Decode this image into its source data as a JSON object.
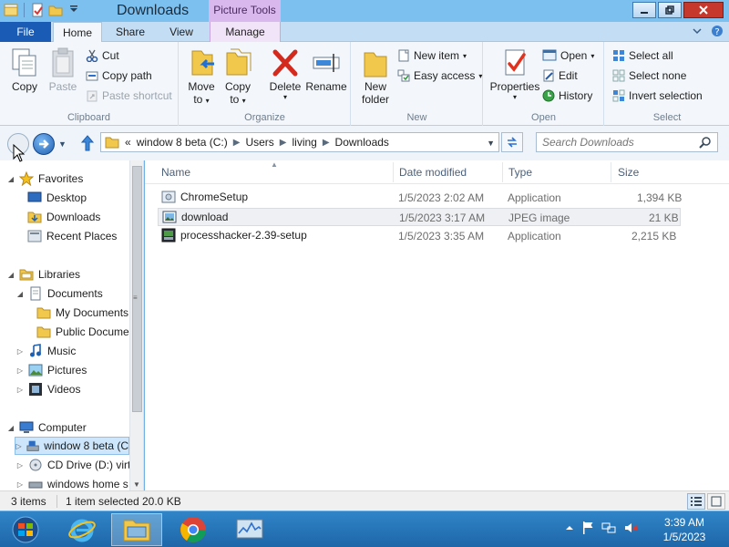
{
  "window": {
    "title": "Downloads",
    "contextual_tab_header": "Picture Tools"
  },
  "tabs": {
    "file": "File",
    "home": "Home",
    "share": "Share",
    "view": "View",
    "manage": "Manage"
  },
  "ribbon": {
    "clipboard": {
      "label": "Clipboard",
      "copy": "Copy",
      "paste": "Paste",
      "cut": "Cut",
      "copy_path": "Copy path",
      "paste_shortcut": "Paste shortcut"
    },
    "organize": {
      "label": "Organize",
      "move_to_1": "Move",
      "move_to_2": "to",
      "copy_to_1": "Copy",
      "copy_to_2": "to",
      "delete": "Delete",
      "rename": "Rename"
    },
    "new": {
      "label": "New",
      "new_folder_1": "New",
      "new_folder_2": "folder",
      "new_item": "New item",
      "easy_access": "Easy access"
    },
    "open": {
      "label": "Open",
      "properties": "Properties",
      "open": "Open",
      "edit": "Edit",
      "history": "History"
    },
    "select": {
      "label": "Select",
      "select_all": "Select all",
      "select_none": "Select none",
      "invert_selection": "Invert selection"
    }
  },
  "address": {
    "overflow": "«",
    "crumbs": [
      "window 8 beta (C:)",
      "Users",
      "living",
      "Downloads"
    ],
    "search_placeholder": "Search Downloads"
  },
  "navpane": {
    "favorites": "Favorites",
    "desktop": "Desktop",
    "downloads": "Downloads",
    "recent_places": "Recent Places",
    "libraries": "Libraries",
    "documents": "Documents",
    "my_documents": "My Documents",
    "public_documents": "Public Docume",
    "music": "Music",
    "pictures": "Pictures",
    "videos": "Videos",
    "computer": "Computer",
    "drive_c": "window 8 beta (C",
    "drive_d": "CD Drive (D:) virt",
    "drive_home": "windows home s"
  },
  "filelist": {
    "columns": {
      "name": "Name",
      "date": "Date modified",
      "type": "Type",
      "size": "Size"
    },
    "rows": [
      {
        "name": "ChromeSetup",
        "date": "1/5/2023 2:02 AM",
        "type": "Application",
        "size": "1,394 KB"
      },
      {
        "name": "download",
        "date": "1/5/2023 3:17 AM",
        "type": "JPEG image",
        "size": "21 KB"
      },
      {
        "name": "processhacker-2.39-setup",
        "date": "1/5/2023 3:35 AM",
        "type": "Application",
        "size": "2,215 KB"
      }
    ]
  },
  "status": {
    "count": "3 items",
    "selection": "1 item selected",
    "size": "20.0 KB"
  },
  "taskbar": {
    "time": "3:39 AM",
    "date": "1/5/2023"
  },
  "colors": {
    "file_tab": "#1a5bb5",
    "titlebar": "#7cc0f0",
    "contextual": "#d9b8ee",
    "taskbar": "#1e66a8",
    "selection": "#cde6fb"
  }
}
